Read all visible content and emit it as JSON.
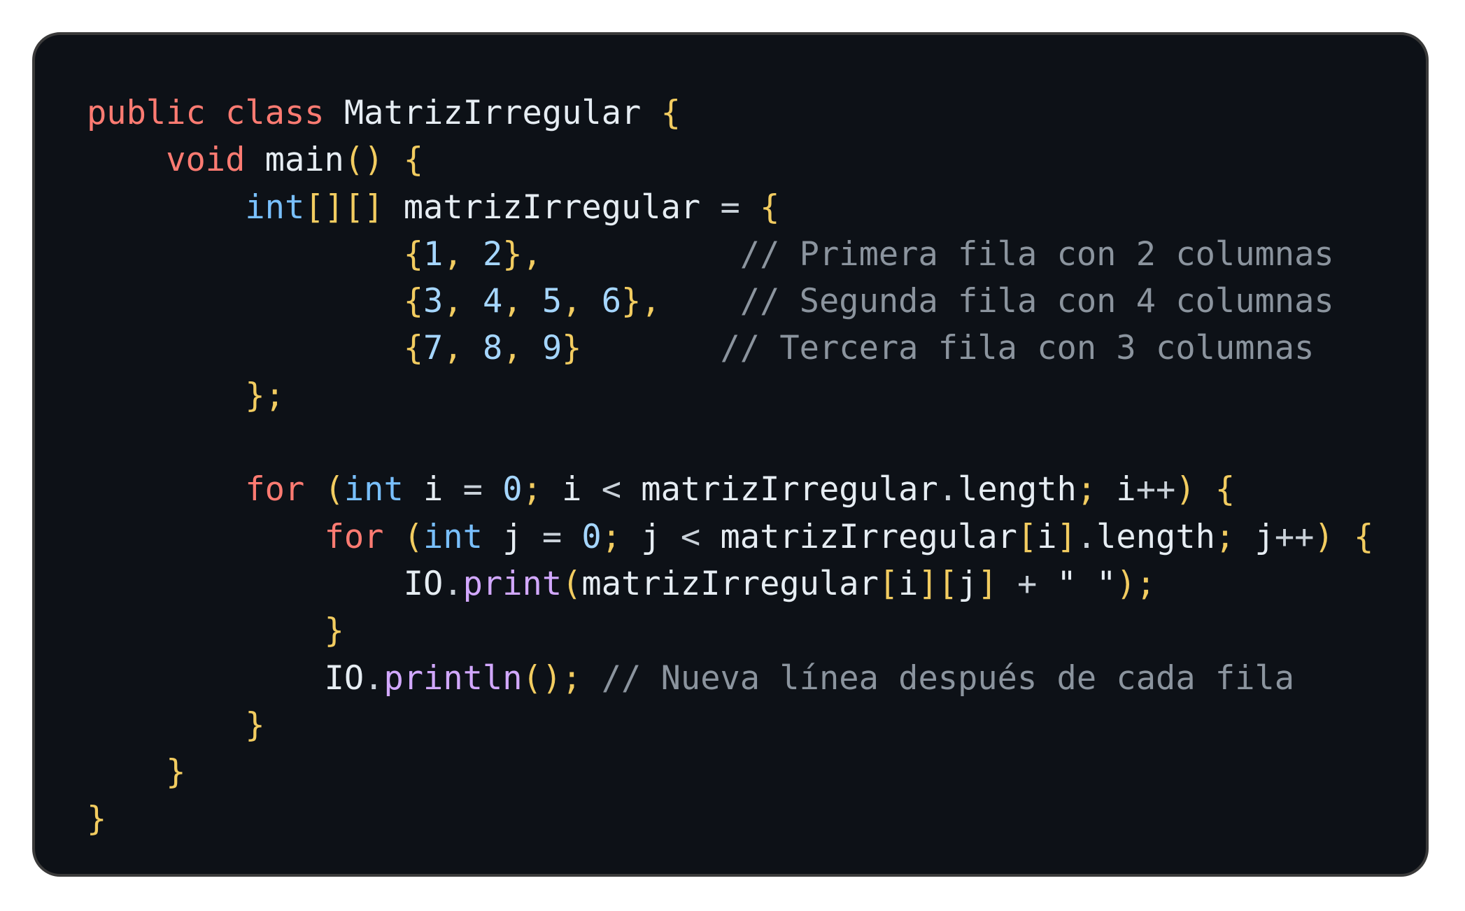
{
  "code": {
    "language": "java",
    "lines": [
      [
        {
          "t": "public",
          "c": "kw"
        },
        {
          "t": " ",
          "c": "plain"
        },
        {
          "t": "class",
          "c": "kw"
        },
        {
          "t": " ",
          "c": "plain"
        },
        {
          "t": "MatrizIrregular",
          "c": "plain"
        },
        {
          "t": " ",
          "c": "plain"
        },
        {
          "t": "{",
          "c": "brace"
        }
      ],
      [
        {
          "t": "    ",
          "c": "plain"
        },
        {
          "t": "void",
          "c": "kw"
        },
        {
          "t": " ",
          "c": "plain"
        },
        {
          "t": "main",
          "c": "plain"
        },
        {
          "t": "()",
          "c": "brace"
        },
        {
          "t": " ",
          "c": "plain"
        },
        {
          "t": "{",
          "c": "brace"
        }
      ],
      [
        {
          "t": "        ",
          "c": "plain"
        },
        {
          "t": "int",
          "c": "type"
        },
        {
          "t": "[][]",
          "c": "brace"
        },
        {
          "t": " ",
          "c": "plain"
        },
        {
          "t": "matrizIrregular",
          "c": "plain"
        },
        {
          "t": " = ",
          "c": "op"
        },
        {
          "t": "{",
          "c": "brace"
        }
      ],
      [
        {
          "t": "                ",
          "c": "plain"
        },
        {
          "t": "{",
          "c": "brace"
        },
        {
          "t": "1",
          "c": "num"
        },
        {
          "t": ", ",
          "c": "punc"
        },
        {
          "t": "2",
          "c": "num"
        },
        {
          "t": "},",
          "c": "brace"
        },
        {
          "t": "          ",
          "c": "plain"
        },
        {
          "t": "// Primera fila con 2 columnas",
          "c": "comment"
        }
      ],
      [
        {
          "t": "                ",
          "c": "plain"
        },
        {
          "t": "{",
          "c": "brace"
        },
        {
          "t": "3",
          "c": "num"
        },
        {
          "t": ", ",
          "c": "punc"
        },
        {
          "t": "4",
          "c": "num"
        },
        {
          "t": ", ",
          "c": "punc"
        },
        {
          "t": "5",
          "c": "num"
        },
        {
          "t": ", ",
          "c": "punc"
        },
        {
          "t": "6",
          "c": "num"
        },
        {
          "t": "},",
          "c": "brace"
        },
        {
          "t": "    ",
          "c": "plain"
        },
        {
          "t": "// Segunda fila con 4 columnas",
          "c": "comment"
        }
      ],
      [
        {
          "t": "                ",
          "c": "plain"
        },
        {
          "t": "{",
          "c": "brace"
        },
        {
          "t": "7",
          "c": "num"
        },
        {
          "t": ", ",
          "c": "punc"
        },
        {
          "t": "8",
          "c": "num"
        },
        {
          "t": ", ",
          "c": "punc"
        },
        {
          "t": "9",
          "c": "num"
        },
        {
          "t": "}",
          "c": "brace"
        },
        {
          "t": "       ",
          "c": "plain"
        },
        {
          "t": "// Tercera fila con 3 columnas",
          "c": "comment"
        }
      ],
      [
        {
          "t": "        ",
          "c": "plain"
        },
        {
          "t": "};",
          "c": "brace"
        }
      ],
      [],
      [
        {
          "t": "        ",
          "c": "plain"
        },
        {
          "t": "for",
          "c": "kw"
        },
        {
          "t": " ",
          "c": "plain"
        },
        {
          "t": "(",
          "c": "brace"
        },
        {
          "t": "int",
          "c": "type"
        },
        {
          "t": " i ",
          "c": "plain"
        },
        {
          "t": "=",
          "c": "op"
        },
        {
          "t": " ",
          "c": "plain"
        },
        {
          "t": "0",
          "c": "num"
        },
        {
          "t": ";",
          "c": "punc"
        },
        {
          "t": " i ",
          "c": "plain"
        },
        {
          "t": "<",
          "c": "op"
        },
        {
          "t": " matrizIrregular",
          "c": "plain"
        },
        {
          "t": ".",
          "c": "op"
        },
        {
          "t": "length",
          "c": "plain"
        },
        {
          "t": ";",
          "c": "punc"
        },
        {
          "t": " i",
          "c": "plain"
        },
        {
          "t": "++",
          "c": "op"
        },
        {
          "t": ")",
          "c": "brace"
        },
        {
          "t": " ",
          "c": "plain"
        },
        {
          "t": "{",
          "c": "brace"
        }
      ],
      [
        {
          "t": "            ",
          "c": "plain"
        },
        {
          "t": "for",
          "c": "kw"
        },
        {
          "t": " ",
          "c": "plain"
        },
        {
          "t": "(",
          "c": "brace"
        },
        {
          "t": "int",
          "c": "type"
        },
        {
          "t": " j ",
          "c": "plain"
        },
        {
          "t": "=",
          "c": "op"
        },
        {
          "t": " ",
          "c": "plain"
        },
        {
          "t": "0",
          "c": "num"
        },
        {
          "t": ";",
          "c": "punc"
        },
        {
          "t": " j ",
          "c": "plain"
        },
        {
          "t": "<",
          "c": "op"
        },
        {
          "t": " matrizIrregular",
          "c": "plain"
        },
        {
          "t": "[",
          "c": "brace"
        },
        {
          "t": "i",
          "c": "plain"
        },
        {
          "t": "]",
          "c": "brace"
        },
        {
          "t": ".",
          "c": "op"
        },
        {
          "t": "length",
          "c": "plain"
        },
        {
          "t": ";",
          "c": "punc"
        },
        {
          "t": " j",
          "c": "plain"
        },
        {
          "t": "++",
          "c": "op"
        },
        {
          "t": ")",
          "c": "brace"
        },
        {
          "t": " ",
          "c": "plain"
        },
        {
          "t": "{",
          "c": "brace"
        }
      ],
      [
        {
          "t": "                ",
          "c": "plain"
        },
        {
          "t": "IO",
          "c": "plain"
        },
        {
          "t": ".",
          "c": "op"
        },
        {
          "t": "print",
          "c": "method"
        },
        {
          "t": "(",
          "c": "brace"
        },
        {
          "t": "matrizIrregular",
          "c": "plain"
        },
        {
          "t": "[",
          "c": "brace"
        },
        {
          "t": "i",
          "c": "plain"
        },
        {
          "t": "][",
          "c": "brace"
        },
        {
          "t": "j",
          "c": "plain"
        },
        {
          "t": "]",
          "c": "brace"
        },
        {
          "t": " + ",
          "c": "op"
        },
        {
          "t": "\" \"",
          "c": "plain"
        },
        {
          "t": ");",
          "c": "brace"
        }
      ],
      [
        {
          "t": "            ",
          "c": "plain"
        },
        {
          "t": "}",
          "c": "brace"
        }
      ],
      [
        {
          "t": "            ",
          "c": "plain"
        },
        {
          "t": "IO",
          "c": "plain"
        },
        {
          "t": ".",
          "c": "op"
        },
        {
          "t": "println",
          "c": "method"
        },
        {
          "t": "();",
          "c": "brace"
        },
        {
          "t": " ",
          "c": "plain"
        },
        {
          "t": "// Nueva línea después de cada fila",
          "c": "comment"
        }
      ],
      [
        {
          "t": "        ",
          "c": "plain"
        },
        {
          "t": "}",
          "c": "brace"
        }
      ],
      [
        {
          "t": "    ",
          "c": "plain"
        },
        {
          "t": "}",
          "c": "brace"
        }
      ],
      [
        {
          "t": "}",
          "c": "brace"
        }
      ]
    ]
  },
  "colors": {
    "background": "#0d1117",
    "keyword": "#ff7b72",
    "type": "#79c0ff",
    "number": "#a5d6ff",
    "brace": "#f2cc60",
    "method": "#d2a8ff",
    "plain": "#e6edf3",
    "comment": "#8b949e"
  }
}
